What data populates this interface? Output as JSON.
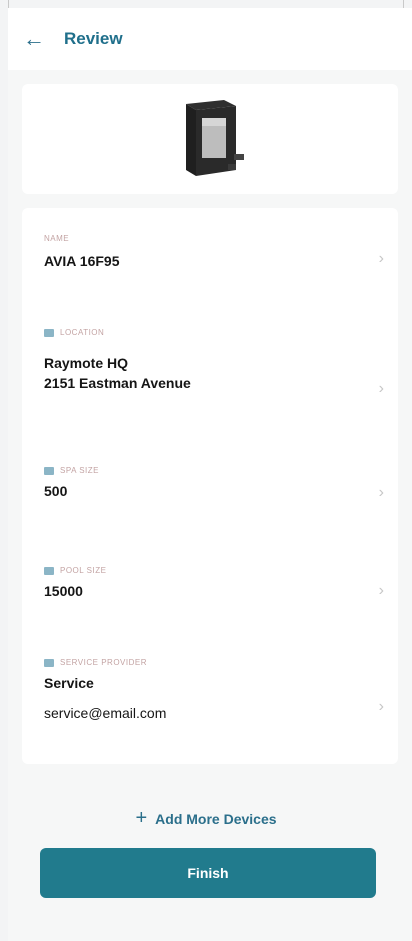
{
  "header": {
    "title": "Review",
    "back_icon": "arrow-left-icon"
  },
  "device": {
    "image_icon": "heater-device-icon"
  },
  "fields": {
    "name": {
      "label": "NAME",
      "value": "AVIA 16F95"
    },
    "location": {
      "label": "LOCATION",
      "line1": "Raymote HQ",
      "line2": "2151 Eastman Avenue"
    },
    "spa_size": {
      "label": "SPA SIZE",
      "value": "500"
    },
    "pool_size": {
      "label": "POOL SIZE",
      "value": "15000"
    },
    "service_provider": {
      "label": "SERVICE PROVIDER",
      "name": "Service",
      "email": "service@email.com"
    }
  },
  "actions": {
    "add_more_label": "Add More Devices",
    "finish_label": "Finish"
  },
  "colors": {
    "accent": "#217b8d",
    "title": "#1f6f8b",
    "label": "#c3a3a3"
  }
}
